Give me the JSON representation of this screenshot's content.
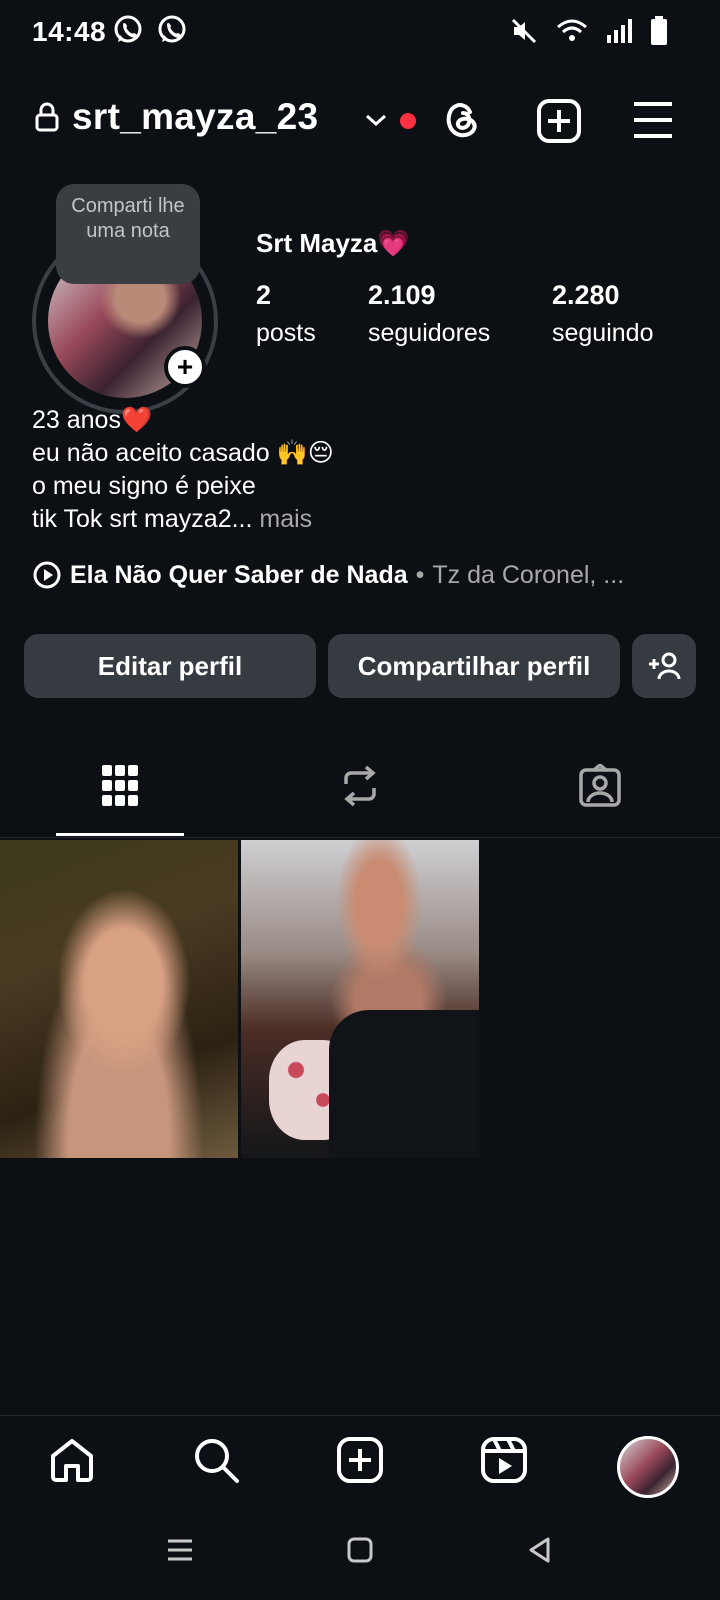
{
  "status_bar": {
    "time": "14:48",
    "left_icons": [
      "whatsapp-icon",
      "whatsapp-icon"
    ],
    "right_icons": [
      "mute-icon",
      "wifi-icon",
      "signal-icon",
      "battery-icon"
    ]
  },
  "header": {
    "username": "srt_mayza_23",
    "icons": [
      "lock-icon",
      "chevron-down-icon",
      "threads-icon",
      "add-square-icon",
      "menu-icon"
    ],
    "notification_dot_color": "#ff3040"
  },
  "profile": {
    "note_text": "Comparti lhe uma nota",
    "display_name": "Srt Mayza💗",
    "stats": {
      "posts_count": "2",
      "posts_label": "posts",
      "followers_count": "2.109",
      "followers_label": "seguidores",
      "following_count": "2.280",
      "following_label": "seguindo"
    },
    "bio": {
      "line1": "23 anos❤️",
      "line2": "eu não aceito casado  🙌😔",
      "line3": "o meu signo é peixe",
      "line4": "tik Tok srt mayza2...",
      "more_label": "mais"
    },
    "music": {
      "song": "Ela Não Quer Saber de Nada",
      "separator": "•",
      "artist": "Tz da Coronel, ..."
    }
  },
  "actions": {
    "edit_label": "Editar perfil",
    "share_label": "Compartilhar perfil"
  },
  "tabs": [
    "grid-icon",
    "repost-icon",
    "tagged-icon"
  ],
  "posts_count_shown": 2,
  "bottom_nav": [
    "home-icon",
    "search-icon",
    "create-icon",
    "reels-icon",
    "profile-avatar"
  ],
  "system_nav": [
    "recents-icon",
    "home-button-icon",
    "back-icon"
  ],
  "colors": {
    "background": "#0c1014",
    "button_bg": "#363a41",
    "muted_text": "#a8a8a8"
  }
}
